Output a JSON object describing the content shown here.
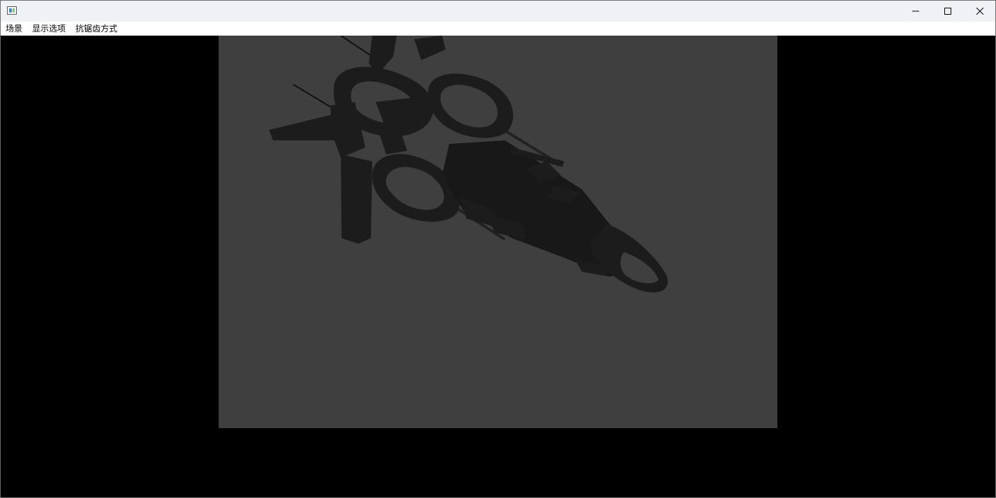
{
  "window": {
    "icon": "app-window-icon"
  },
  "menu": {
    "items": [
      {
        "label": "场景"
      },
      {
        "label": "显示选项"
      },
      {
        "label": "抗锯齿方式"
      }
    ]
  },
  "viewport": {
    "scene_background": "#3f3f3f",
    "background": "#000000",
    "model_color": "#1c1c1c"
  },
  "controls": {
    "minimize_icon": "minimize-icon",
    "maximize_icon": "maximize-icon",
    "close_icon": "close-icon"
  }
}
